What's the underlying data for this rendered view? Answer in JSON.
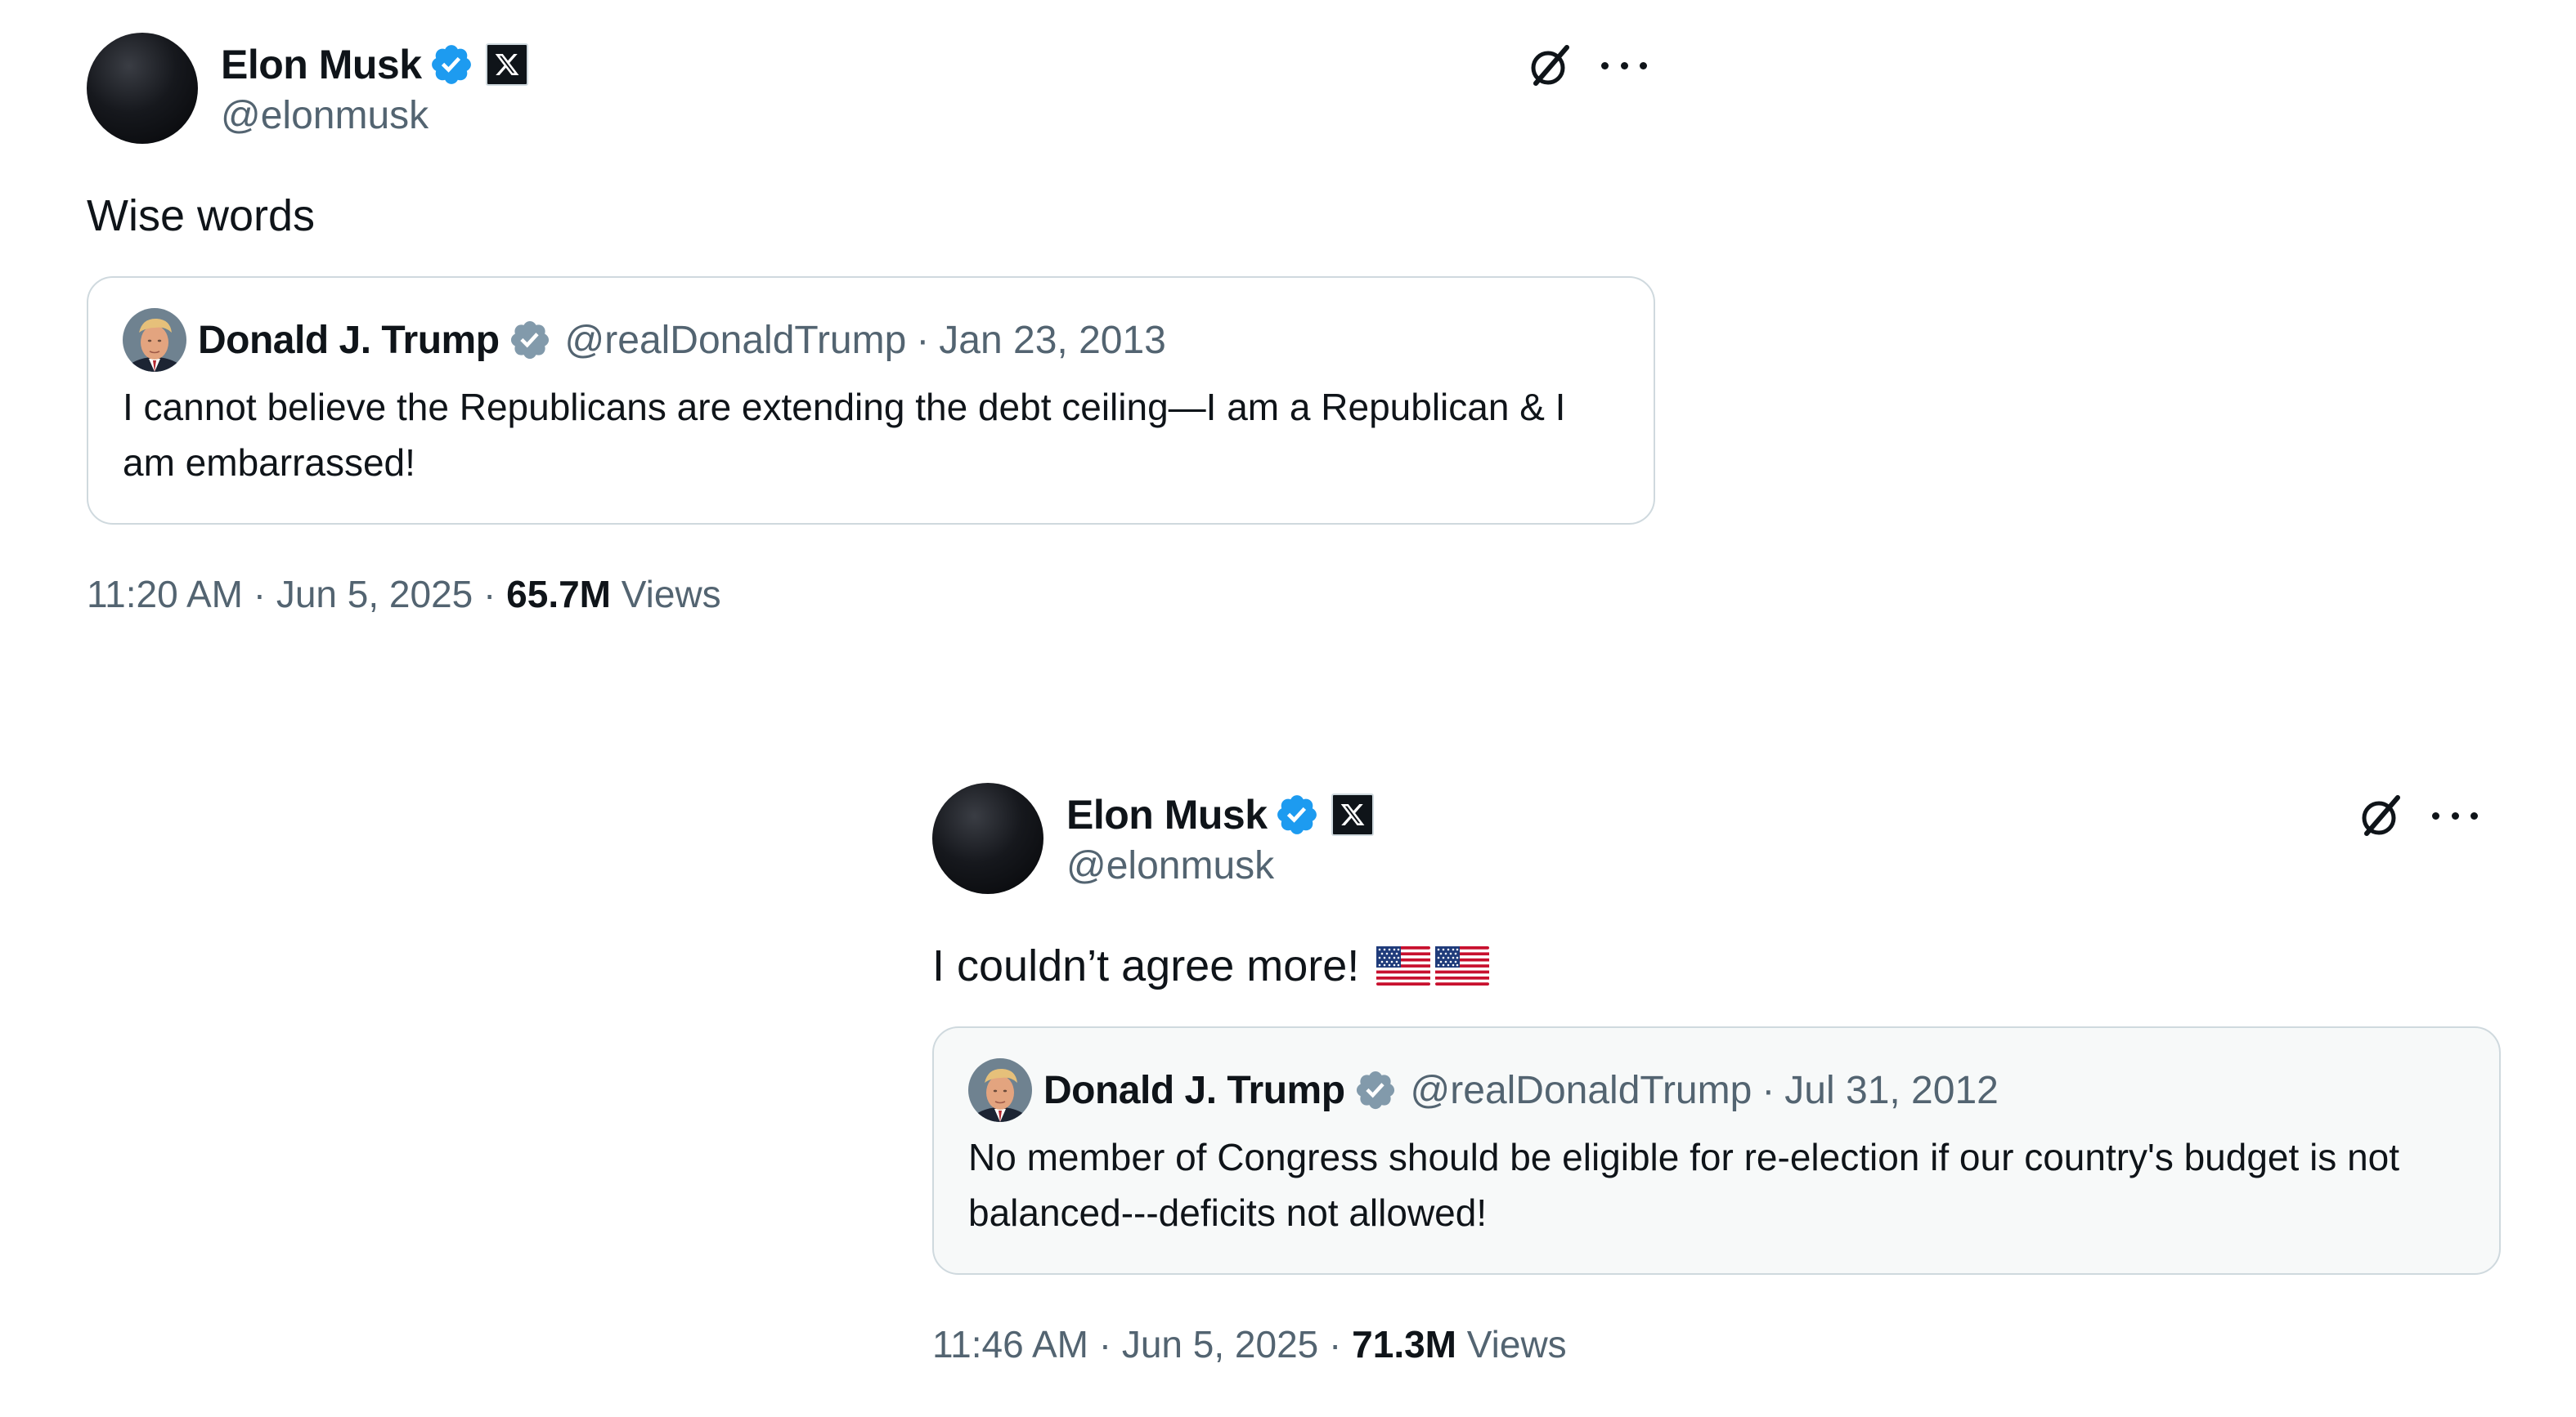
{
  "tweets": [
    {
      "author": {
        "name": "Elon Musk",
        "handle": "@elonmusk"
      },
      "text": "Wise words",
      "quote": {
        "author": {
          "name": "Donald J. Trump",
          "handle": "@realDonaldTrump"
        },
        "separator": "·",
        "date": "Jan 23, 2013",
        "text": "I cannot believe the Republicans are extending the debt ceiling—I am a Republican & I am embarrassed!"
      },
      "time": "11:20 AM",
      "date": "Jun 5, 2025",
      "separator": "·",
      "views_count": "65.7M",
      "views_label": "Views"
    },
    {
      "author": {
        "name": "Elon Musk",
        "handle": "@elonmusk"
      },
      "text": "I couldn’t agree more!",
      "emoji": "🇺🇸🇺🇸",
      "quote": {
        "author": {
          "name": "Donald J. Trump",
          "handle": "@realDonaldTrump"
        },
        "separator": "·",
        "date": "Jul 31, 2012",
        "text": "No member of Congress should be eligible for re-election if our country's budget is not balanced---deficits not allowed!"
      },
      "time": "11:46 AM",
      "date": "Jun 5, 2025",
      "separator": "·",
      "views_count": "71.3M",
      "views_label": "Views"
    }
  ],
  "colors": {
    "text_primary": "#0f1419",
    "text_secondary": "#536471",
    "verified_blue": "#1d9bf0",
    "verified_gray": "#829aab",
    "border": "#cfd9de",
    "quote_bg_second": "#f7f9f9"
  },
  "icons": {
    "verified": "verified-badge-icon",
    "affiliate": "x-logo-icon",
    "grok": "grok-icon",
    "more": "more-options-icon",
    "flag": "us-flag-icon"
  }
}
